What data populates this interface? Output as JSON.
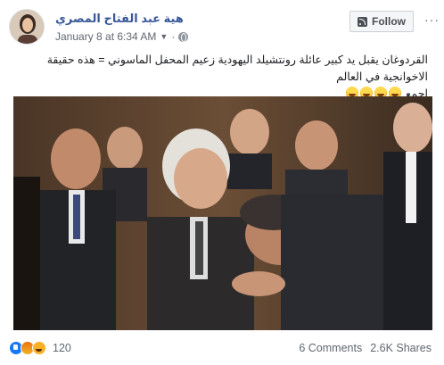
{
  "post": {
    "author": "هية عبد الفتاح المصري",
    "timestamp": "January 8 at 6:34 AM",
    "caret_icon": "caret-down-icon",
    "audience_icon": "globe-icon",
    "follow_label": "Follow",
    "more_label": "···",
    "text_line1": "القردوغان يقبل يد كبير عائلة رونتشيلد اليهودية زعيم المحفل الماسوني = هذه حقيقة الاخوانجية في العالم",
    "text_line2": "اجمع",
    "emoji_count": 4
  },
  "footer": {
    "reactions": [
      "like",
      "angry",
      "haha"
    ],
    "reaction_count": "120",
    "comments": "6 Comments",
    "shares": "2.6K Shares"
  },
  "colors": {
    "link": "#385898",
    "muted": "#606770",
    "like": "#1877f2",
    "haha": "#f7b125"
  }
}
